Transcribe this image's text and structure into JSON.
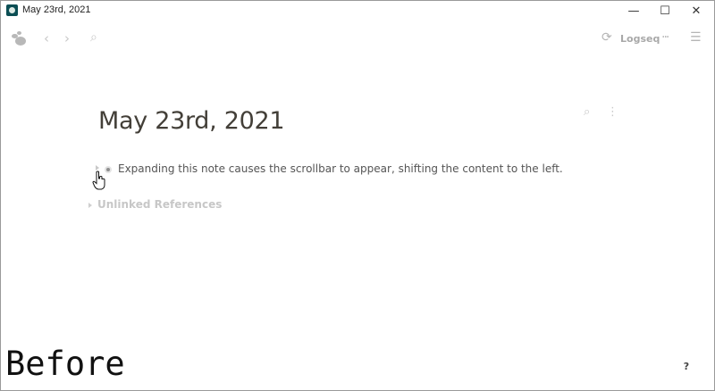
{
  "window": {
    "title": "May 23rd, 2021",
    "minimize_glyph": "—",
    "maximize_glyph": "☐",
    "close_glyph": "✕"
  },
  "header": {
    "logo_icon": "logseq-logo-icon",
    "back_glyph": "‹",
    "forward_glyph": "›",
    "search_glyph": "⌕",
    "sync_glyph": "⟳",
    "repo_label": "Logseq",
    "more_glyph": "···",
    "menu_glyph": "☰"
  },
  "page": {
    "title": "May 23rd, 2021",
    "search_glyph": "⌕",
    "more_glyph": "⋮",
    "blocks": [
      {
        "text": "Expanding this note causes the scrollbar to appear, shifting the content to the left."
      }
    ],
    "unlinked_references_label": "Unlinked References"
  },
  "overlay": {
    "caption": "Before",
    "help_label": "?"
  }
}
